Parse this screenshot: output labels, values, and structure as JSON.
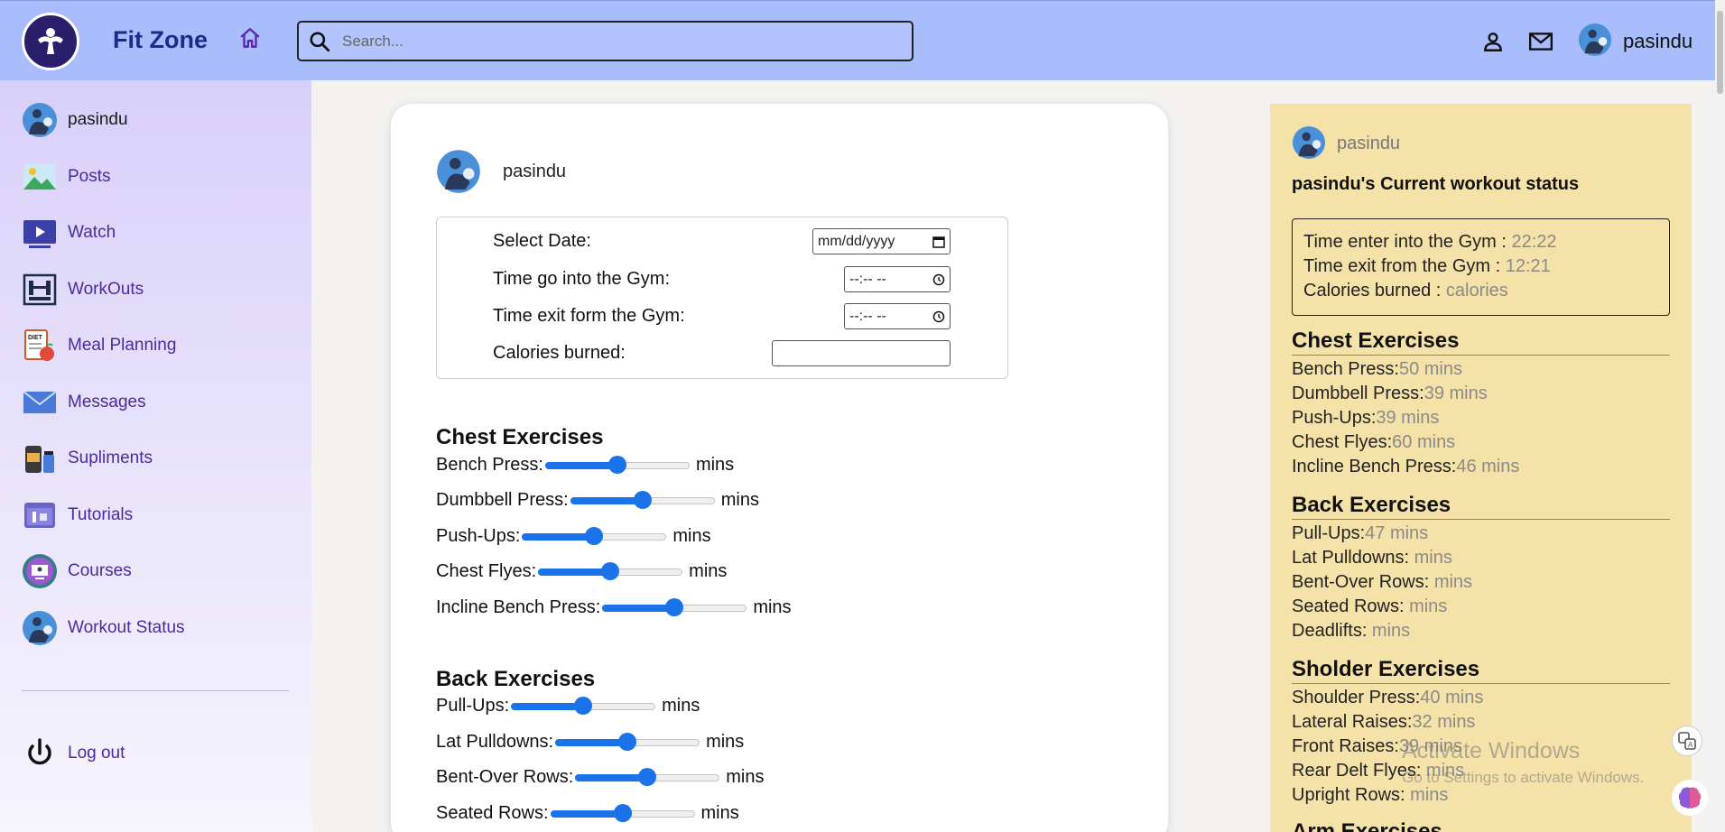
{
  "header": {
    "brand": "Fit Zone",
    "search_placeholder": "Search...",
    "username": "pasindu"
  },
  "sidebar": {
    "items": [
      {
        "label": "pasindu",
        "icon": "avatar-icon"
      },
      {
        "label": "Posts",
        "icon": "image-icon"
      },
      {
        "label": "Watch",
        "icon": "video-icon"
      },
      {
        "label": "WorkOuts",
        "icon": "gym-icon"
      },
      {
        "label": "Meal Planning",
        "icon": "diet-icon"
      },
      {
        "label": "Messages",
        "icon": "envelope-icon"
      },
      {
        "label": "Supliments",
        "icon": "supplement-icon"
      },
      {
        "label": "Tutorials",
        "icon": "tutorial-icon"
      },
      {
        "label": "Courses",
        "icon": "courses-icon"
      },
      {
        "label": "Workout Status",
        "icon": "avatar-icon"
      }
    ],
    "logout_label": "Log out"
  },
  "form": {
    "username": "pasindu",
    "date_label": "Select Date:",
    "date_value": "mm/dd/yyyy",
    "time_in_label": "Time go into the Gym:",
    "time_in_value": "--:-- --",
    "time_out_label": "Time exit form the Gym:",
    "time_out_value": "--:-- --",
    "calories_label": "Calories burned:",
    "calories_value": ""
  },
  "exercises": {
    "unit": "mins",
    "chest": {
      "title": "Chest Exercises",
      "items": [
        {
          "label": "Bench Press:",
          "level": 0.5
        },
        {
          "label": "Dumbbell Press:",
          "level": 0.5
        },
        {
          "label": "Push-Ups:",
          "level": 0.5
        },
        {
          "label": "Chest Flyes:",
          "level": 0.5
        },
        {
          "label": "Incline Bench Press:",
          "level": 0.5
        }
      ]
    },
    "back": {
      "title": "Back Exercises",
      "items": [
        {
          "label": "Pull-Ups:",
          "level": 0.5
        },
        {
          "label": "Lat Pulldowns:",
          "level": 0.5
        },
        {
          "label": "Bent-Over Rows:",
          "level": 0.5
        },
        {
          "label": "Seated Rows:",
          "level": 0.5
        }
      ]
    }
  },
  "status": {
    "username": "pasindu",
    "title": "pasindu's Current workout status",
    "time_in_label": "Time enter into the Gym : ",
    "time_in_value": "22:22",
    "time_out_label": "Time exit from the Gym : ",
    "time_out_value": "12:21",
    "calories_label": "Calories burned : ",
    "calories_value": "calories",
    "sections": [
      {
        "title": "Chest Exercises",
        "items": [
          {
            "label": "Bench Press:",
            "value": "50 mins"
          },
          {
            "label": "Dumbbell Press:",
            "value": "39 mins"
          },
          {
            "label": "Push-Ups:",
            "value": "39 mins"
          },
          {
            "label": "Chest Flyes:",
            "value": "60 mins"
          },
          {
            "label": "Incline Bench Press:",
            "value": "46 mins"
          }
        ]
      },
      {
        "title": "Back Exercises",
        "items": [
          {
            "label": "Pull-Ups:",
            "value": "47 mins"
          },
          {
            "label": "Lat Pulldowns:",
            "value": " mins"
          },
          {
            "label": "Bent-Over Rows:",
            "value": " mins"
          },
          {
            "label": "Seated Rows:",
            "value": " mins"
          },
          {
            "label": "Deadlifts:",
            "value": " mins"
          }
        ]
      },
      {
        "title": "Sholder Exercises",
        "items": [
          {
            "label": "Shoulder Press:",
            "value": "40 mins"
          },
          {
            "label": "Lateral Raises:",
            "value": "32 mins"
          },
          {
            "label": "Front Raises:",
            "value": "39 mins"
          },
          {
            "label": "Rear Delt Flyes:",
            "value": " mins"
          },
          {
            "label": "Upright Rows:",
            "value": " mins"
          }
        ]
      },
      {
        "title": "Arm Exercises",
        "items": []
      }
    ]
  },
  "watermark": {
    "line1": "Activate Windows",
    "line2": "Go to Settings to activate Windows."
  },
  "colors": {
    "header_bg": "#a9bcfb",
    "accent": "#1a73e8",
    "status_panel_bg": "#f5e2a8",
    "nav_text": "#4b2aa0"
  }
}
